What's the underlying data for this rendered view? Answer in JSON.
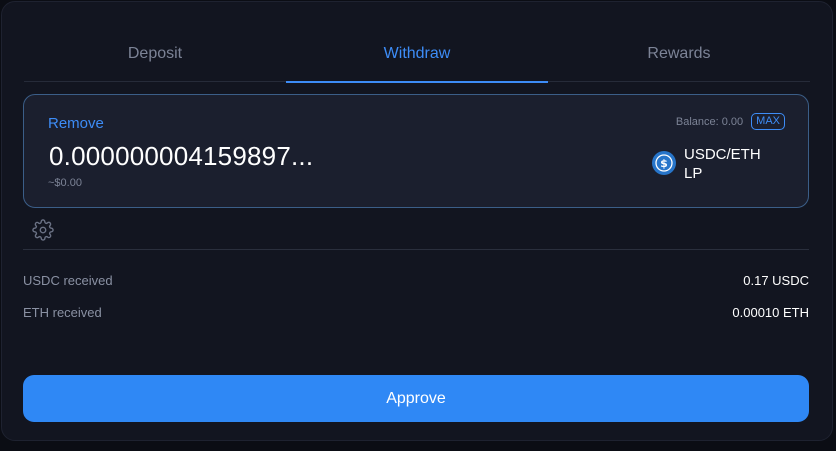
{
  "tabs": [
    {
      "label": "Deposit",
      "active": false
    },
    {
      "label": "Withdraw",
      "active": true
    },
    {
      "label": "Rewards",
      "active": false
    }
  ],
  "input_card": {
    "label": "Remove",
    "amount": "0.000000004159897...",
    "usd_value": "~$0.00",
    "balance": "Balance: 0.00",
    "max_label": "MAX",
    "token_name": "USDC/ETH LP",
    "token_icon": "usdc-coin-icon"
  },
  "settings_icon": "gear-icon",
  "receipts": [
    {
      "label": "USDC received",
      "value": "0.17 USDC"
    },
    {
      "label": "ETH received",
      "value": "0.00010 ETH"
    }
  ],
  "approve_label": "Approve",
  "colors": {
    "accent": "#3d8cf6",
    "button": "#2f88f5",
    "background": "#121520",
    "card": "#1b1f2e",
    "usdc": "#2775ca"
  }
}
